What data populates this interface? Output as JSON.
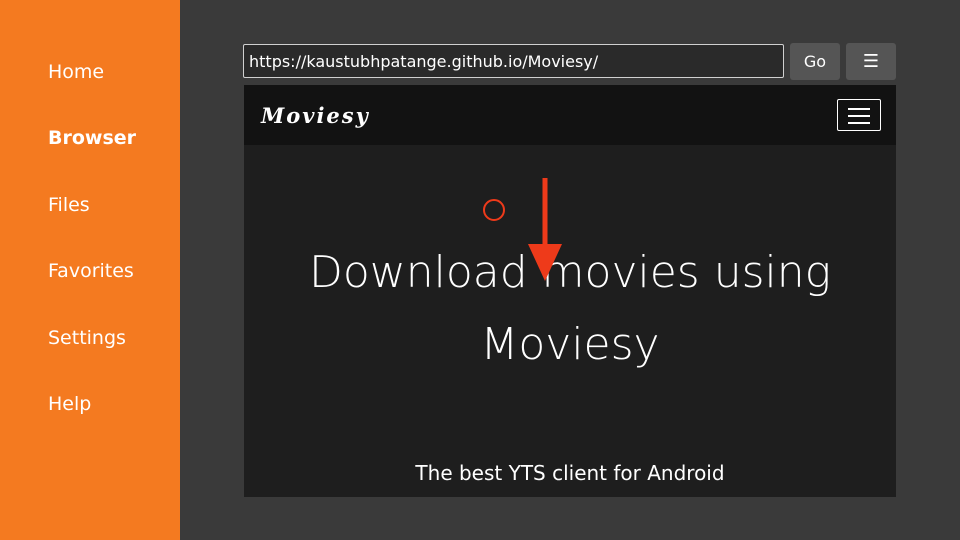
{
  "sidebar": {
    "items": [
      {
        "label": "Home",
        "active": false
      },
      {
        "label": "Browser",
        "active": true
      },
      {
        "label": "Files",
        "active": false
      },
      {
        "label": "Favorites",
        "active": false
      },
      {
        "label": "Settings",
        "active": false
      },
      {
        "label": "Help",
        "active": false
      }
    ]
  },
  "toolbar": {
    "url": "https://kaustubhpatange.github.io/Moviesy/",
    "go_label": "Go",
    "menu_label": "☰"
  },
  "webpage": {
    "brand": "Moviesy",
    "hero_title_line1": "Download movies using",
    "hero_title_line2": "Moviesy",
    "hero_subtitle": "The best YTS client for Android"
  },
  "annotation": {
    "arrow_color": "#ee3a1a",
    "cursor_color": "#ee3a1a"
  },
  "colors": {
    "sidebar": "#f47a20",
    "background": "#3a3a3a",
    "webview": "#1e1e1e",
    "site_nav": "#121212"
  }
}
